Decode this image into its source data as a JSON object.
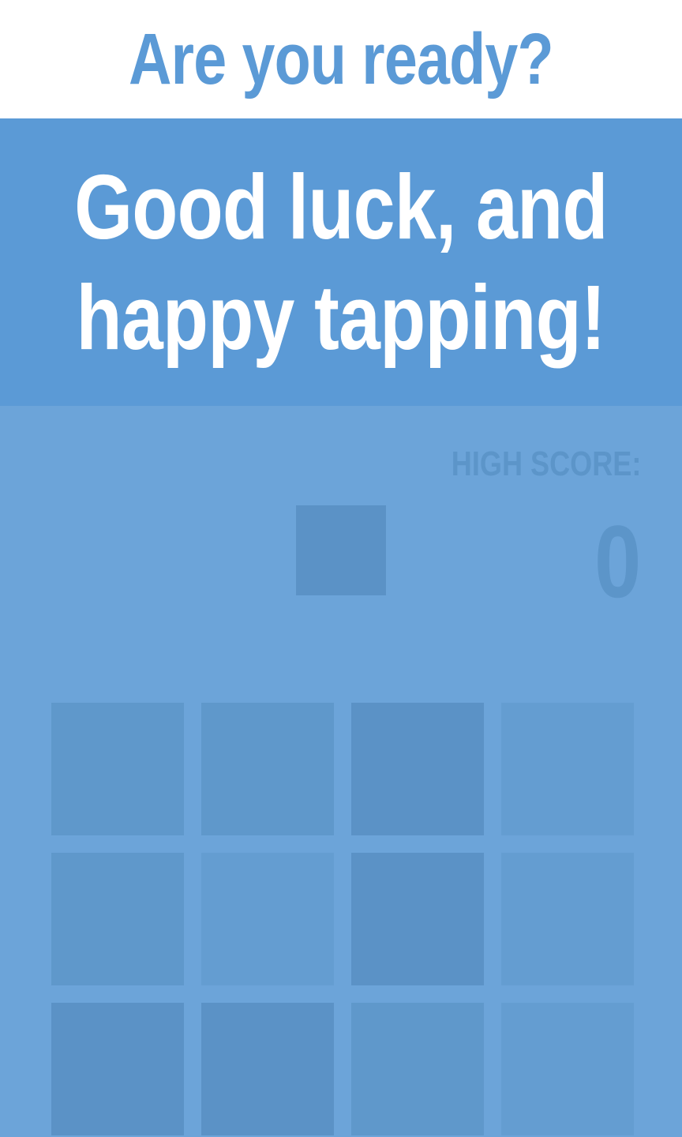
{
  "header": {
    "title": "Are you ready?"
  },
  "message": {
    "line1": "Good luck, and",
    "line2": "happy tapping!"
  },
  "score": {
    "label": "HIGH SCORE:",
    "value": "0"
  },
  "colors": {
    "background": "#6ca4d9",
    "banner": "#5b9ad6",
    "header_bg": "#ffffff",
    "tile_dark": "#5b92c6",
    "tile_mid": "#5f98cb",
    "tile_light": "#649dd1"
  },
  "grid": {
    "columns": 4,
    "visible_rows": 3,
    "tiles": [
      {
        "shade": "tile_mid"
      },
      {
        "shade": "tile_mid"
      },
      {
        "shade": "tile_dark"
      },
      {
        "shade": "tile_light"
      },
      {
        "shade": "tile_mid"
      },
      {
        "shade": "tile_light"
      },
      {
        "shade": "tile_dark"
      },
      {
        "shade": "tile_light"
      },
      {
        "shade": "tile_dark"
      },
      {
        "shade": "tile_dark"
      },
      {
        "shade": "tile_mid"
      },
      {
        "shade": "tile_light"
      }
    ]
  }
}
